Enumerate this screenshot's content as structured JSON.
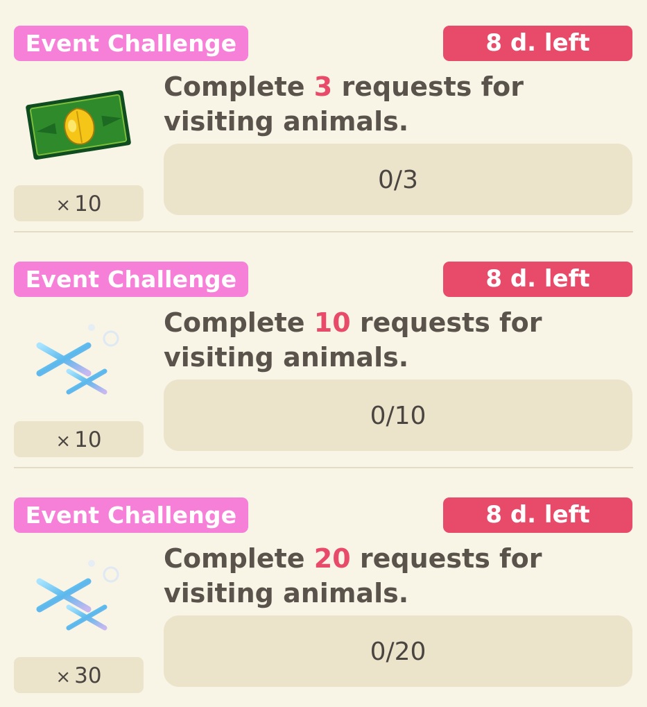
{
  "challenges": [
    {
      "tag": "Event Challenge",
      "time_left": "8 d. left",
      "desc_prefix": "Complete ",
      "desc_count": "3",
      "desc_suffix": " requests for visiting animals.",
      "progress": "0/3",
      "reward_multiplier": "×",
      "reward_qty": "10",
      "reward_icon": "leaf-ticket-icon"
    },
    {
      "tag": "Event Challenge",
      "time_left": "8 d. left",
      "desc_prefix": "Complete ",
      "desc_count": "10",
      "desc_suffix": " requests for visiting animals.",
      "progress": "0/10",
      "reward_multiplier": "×",
      "reward_qty": "10",
      "reward_icon": "snowflake-icon"
    },
    {
      "tag": "Event Challenge",
      "time_left": "8 d. left",
      "desc_prefix": "Complete ",
      "desc_count": "20",
      "desc_suffix": " requests for visiting animals.",
      "progress": "0/20",
      "reward_multiplier": "×",
      "reward_qty": "30",
      "reward_icon": "snowflake-icon"
    }
  ],
  "colors": {
    "background": "#f8f4e6",
    "tag": "#f67fd8",
    "timer": "#e84b6a",
    "highlight": "#e84b6a",
    "panel": "#ebe3ca"
  }
}
